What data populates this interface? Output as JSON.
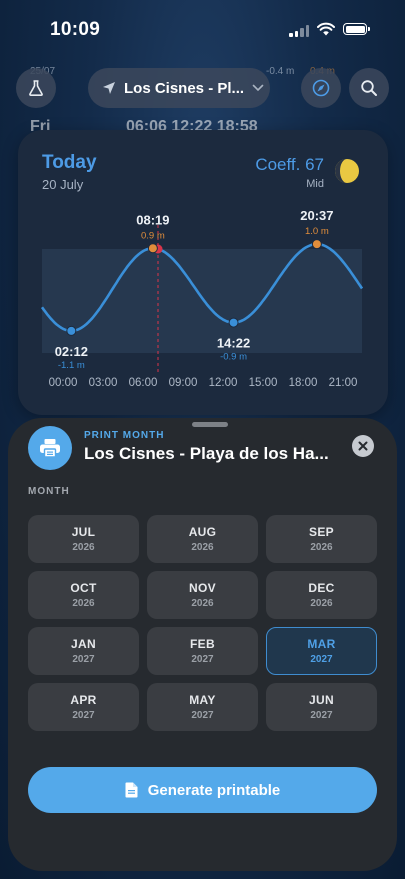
{
  "status_bar": {
    "time": "10:09"
  },
  "background_list": {
    "row1_date": "25/07",
    "row1_heights": "-0.4 m",
    "row1_height_orange": "0.4 m",
    "row2_day": "Fri",
    "row2_times": "06:06   12:22   18:58"
  },
  "header": {
    "location": "Los Cisnes - Pl...",
    "lab_icon": "flask-icon",
    "compass_icon": "compass-icon",
    "search_icon": "search-icon"
  },
  "tide_card": {
    "day_label": "Today",
    "date": "20 July",
    "coefficient": "Coeff. 67",
    "coefficient_level": "Mid",
    "moon_icon": "moon-phase-icon",
    "extremes": [
      {
        "time": "02:12",
        "height": "-1.1 m",
        "type": "low"
      },
      {
        "time": "08:19",
        "height": "0.9 m",
        "type": "high"
      },
      {
        "time": "14:22",
        "height": "-0.9 m",
        "type": "low"
      },
      {
        "time": "20:37",
        "height": "1.0 m",
        "type": "high"
      }
    ],
    "x_ticks": [
      "00:00",
      "03:00",
      "06:00",
      "09:00",
      "12:00",
      "15:00",
      "18:00",
      "21:00"
    ],
    "colors": {
      "accent": "#4d9be6",
      "high": "#e08d3b",
      "low": "#3a8fd8",
      "now": "#d9344a"
    }
  },
  "sheet": {
    "eyebrow": "PRINT MONTH",
    "title": "Los Cisnes - Playa de los Ha...",
    "section_label": "MONTH",
    "months": [
      {
        "month": "JUL",
        "year": "2026",
        "selected": false
      },
      {
        "month": "AUG",
        "year": "2026",
        "selected": false
      },
      {
        "month": "SEP",
        "year": "2026",
        "selected": false
      },
      {
        "month": "OCT",
        "year": "2026",
        "selected": false
      },
      {
        "month": "NOV",
        "year": "2026",
        "selected": false
      },
      {
        "month": "DEC",
        "year": "2026",
        "selected": false
      },
      {
        "month": "JAN",
        "year": "2027",
        "selected": false
      },
      {
        "month": "FEB",
        "year": "2027",
        "selected": false
      },
      {
        "month": "MAR",
        "year": "2027",
        "selected": true
      },
      {
        "month": "APR",
        "year": "2027",
        "selected": false
      },
      {
        "month": "MAY",
        "year": "2027",
        "selected": false
      },
      {
        "month": "JUN",
        "year": "2027",
        "selected": false
      }
    ],
    "generate_label": "Generate printable",
    "colors": {
      "accent": "#54a9ea"
    }
  }
}
